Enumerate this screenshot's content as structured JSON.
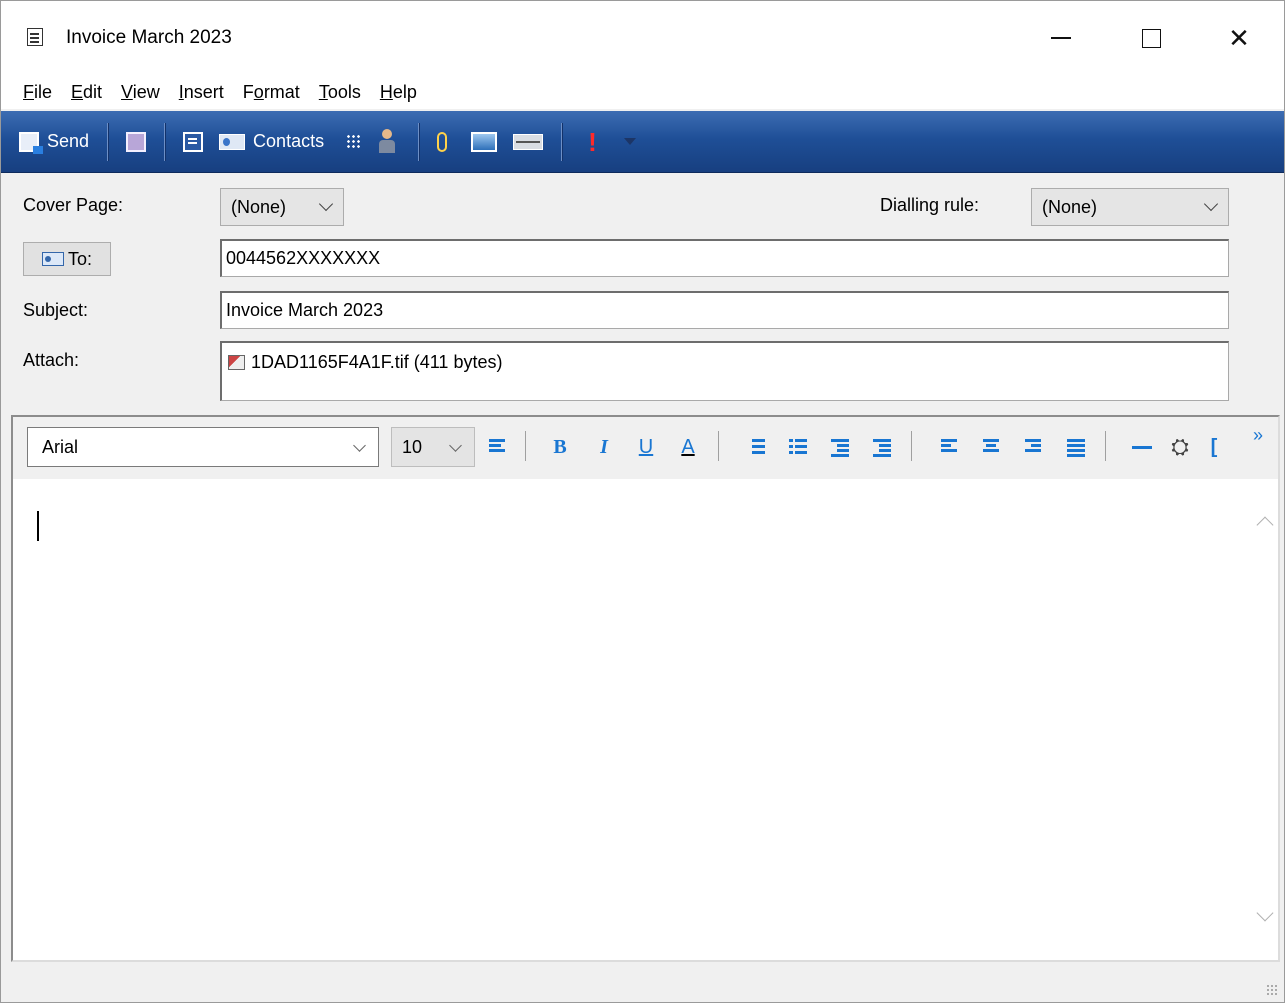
{
  "window": {
    "title": "Invoice March 2023"
  },
  "menu": [
    {
      "pre": "",
      "key": "F",
      "post": "ile"
    },
    {
      "pre": "",
      "key": "E",
      "post": "dit"
    },
    {
      "pre": "",
      "key": "V",
      "post": "iew"
    },
    {
      "pre": "",
      "key": "I",
      "post": "nsert"
    },
    {
      "pre": "F",
      "key": "o",
      "post": "rmat"
    },
    {
      "pre": "",
      "key": "T",
      "post": "ools"
    },
    {
      "pre": "",
      "key": "H",
      "post": "elp"
    }
  ],
  "toolbar": {
    "send_label": "Send",
    "contacts_label": "Contacts"
  },
  "form": {
    "cover_page_label": "Cover Page:",
    "cover_page_value": "(None)",
    "dialling_rule_label": "Dialling rule:",
    "dialling_rule_value": "(None)",
    "to_label": "To:",
    "to_value": "0044562XXXXXXX",
    "subject_label": "Subject:",
    "subject_value": "Invoice March 2023",
    "attach_label": "Attach:",
    "attachment": "1DAD1165F4A1F.tif (411 bytes)"
  },
  "format_bar": {
    "font": "Arial",
    "size": "10",
    "bold": "B",
    "italic": "I",
    "underline": "U",
    "font_color": "A",
    "more": "»"
  },
  "colors": {
    "toolbar_top": "#3d6db3",
    "toolbar_bottom": "#173f80",
    "format_icon": "#1976d2"
  }
}
